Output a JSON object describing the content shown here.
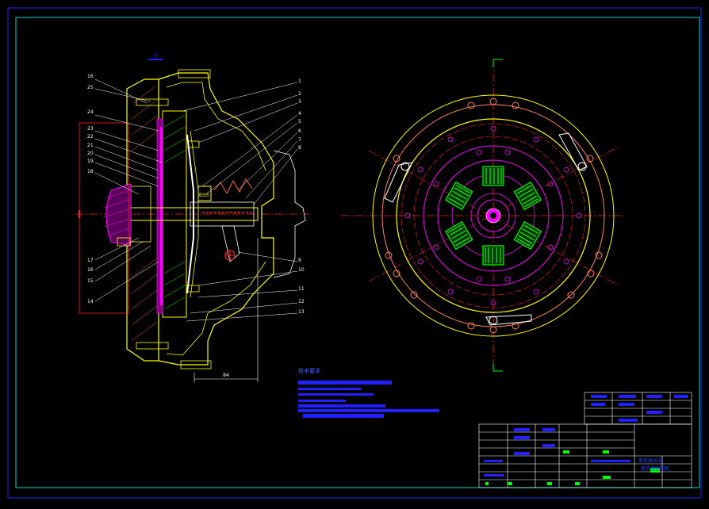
{
  "colors": {
    "background": "#000000",
    "frame": "#00d6d6",
    "part": "#ffff00",
    "detail": "#ffffff",
    "center": "#ff2020",
    "magenta": "#ff00ff",
    "green": "#00ff00",
    "blue": "#2020ff",
    "leader": "#ffffff"
  },
  "balloons_left": [
    "16",
    "25",
    "24",
    "23",
    "22",
    "21",
    "20",
    "19",
    "18",
    "17",
    "16",
    "15",
    "14"
  ],
  "balloons_right": [
    "1",
    "2",
    "3",
    "4",
    "5",
    "6",
    "7",
    "8",
    "9",
    "10",
    "11",
    "12",
    "13"
  ],
  "dimension": "84",
  "view_mark": "A",
  "notes_title": "技术要求",
  "title_block_name": "离合器总成",
  "title_block_drawing": "离合器装配图"
}
